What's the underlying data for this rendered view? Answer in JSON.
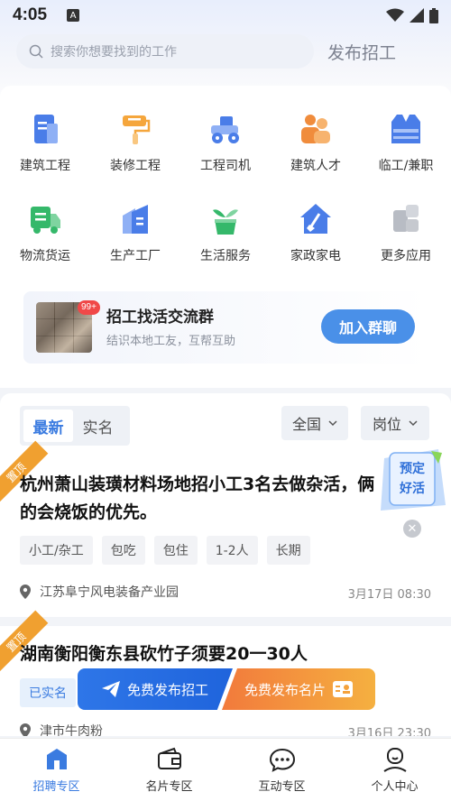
{
  "status_bar": {
    "time": "4:05",
    "notification": "A"
  },
  "search": {
    "placeholder": "搜索你想要找到的工作"
  },
  "header": {
    "publish_label": "发布招工"
  },
  "categories": [
    {
      "label": "建筑工程",
      "icon": "building-icon"
    },
    {
      "label": "装修工程",
      "icon": "paint-roller-icon"
    },
    {
      "label": "工程司机",
      "icon": "tractor-icon"
    },
    {
      "label": "建筑人才",
      "icon": "workers-icon"
    },
    {
      "label": "临工/兼职",
      "icon": "vest-icon"
    },
    {
      "label": "物流货运",
      "icon": "truck-icon"
    },
    {
      "label": "生产工厂",
      "icon": "factory-icon"
    },
    {
      "label": "生活服务",
      "icon": "plant-icon"
    },
    {
      "label": "家政家电",
      "icon": "house-broom-icon"
    },
    {
      "label": "更多应用",
      "icon": "more-icon"
    }
  ],
  "group_card": {
    "badge": "99+",
    "title": "招工找活交流群",
    "subtitle": "结识本地工友，互帮互助",
    "button": "加入群聊"
  },
  "list": {
    "tabs": [
      {
        "label": "最新",
        "active": true
      },
      {
        "label": "实名",
        "active": false
      }
    ],
    "filters": {
      "region": "全国",
      "position": "岗位"
    }
  },
  "jobs": [
    {
      "badge": "置顶",
      "title": "杭州萧山装璜材料场地招小工3名去做杂活，俩的会烧饭的优先。",
      "tags": [
        "小工/杂工",
        "包吃",
        "包住",
        "1-2人",
        "长期"
      ],
      "location": "江苏阜宁风电装备产业园",
      "time": "3月17日 08:30"
    },
    {
      "badge": "置顶",
      "title": "湖南衡阳衡东县砍竹子须要20一30人",
      "tags": [
        "已实名"
      ],
      "location": "津市牛肉粉",
      "time": "3月16日 23:30"
    }
  ],
  "float_card": {
    "line1": "预定",
    "line2": "好活"
  },
  "fab": {
    "left": "免费发布招工",
    "right": "免费发布名片"
  },
  "bottom_nav": [
    {
      "label": "招聘专区",
      "active": true
    },
    {
      "label": "名片专区",
      "active": false
    },
    {
      "label": "互动专区",
      "active": false
    },
    {
      "label": "个人中心",
      "active": false
    }
  ],
  "colors": {
    "accent": "#3a7be0",
    "orange": "#f0a030",
    "page_bg": "#f2f4f8"
  }
}
